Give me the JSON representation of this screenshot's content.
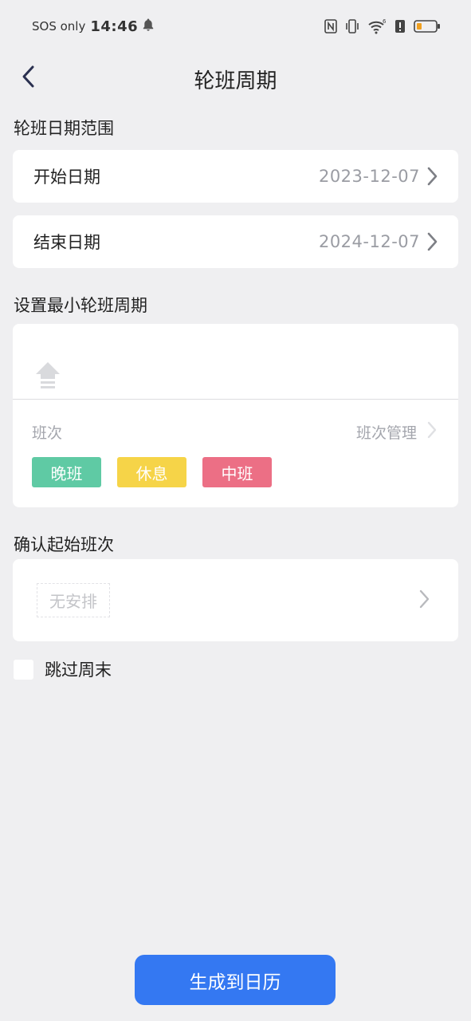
{
  "status_bar": {
    "carrier": "SOS only",
    "time": "14:46",
    "icons": [
      "bell-icon",
      "nfc-icon",
      "vibrate-icon",
      "wifi-icon",
      "battery-alert-icon",
      "battery-icon"
    ]
  },
  "header": {
    "title": "轮班周期",
    "back_icon": "chevron-left-icon"
  },
  "date_range": {
    "section_title": "轮班日期范围",
    "start_label": "开始日期",
    "start_value": "2023-12-07",
    "end_label": "结束日期",
    "end_value": "2024-12-07"
  },
  "min_cycle": {
    "section_title": "设置最小轮班周期",
    "shift_label": "班次",
    "manage_label": "班次管理",
    "shifts": [
      {
        "label": "晚班",
        "color": "#5fcaa4"
      },
      {
        "label": "休息",
        "color": "#f6d448"
      },
      {
        "label": "中班",
        "color": "#ec6f85"
      }
    ]
  },
  "start_shift": {
    "section_title": "确认起始班次",
    "value": "无安排"
  },
  "skip_weekend": {
    "label": "跳过周末",
    "checked": false
  },
  "generate_button": {
    "label": "生成到日历",
    "color": "#3478f2"
  }
}
